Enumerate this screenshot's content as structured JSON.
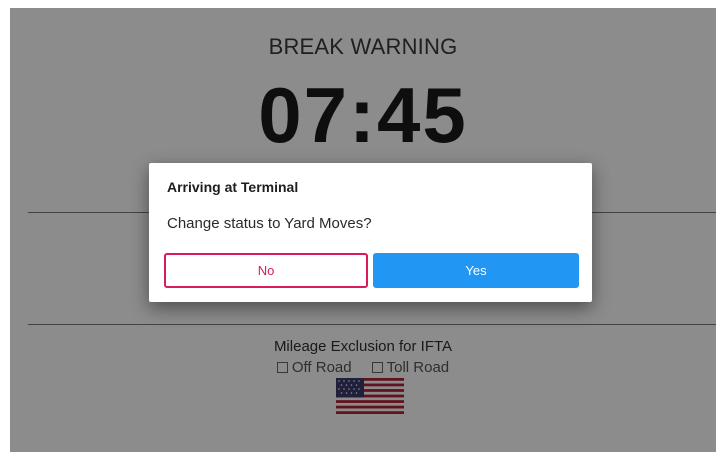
{
  "screen": {
    "title": "BREAK WARNING",
    "timer": "07:45"
  },
  "ifta": {
    "title": "Mileage Exclusion for IFTA",
    "options": [
      {
        "label": "Off Road",
        "checked": false
      },
      {
        "label": "Toll Road",
        "checked": false
      }
    ],
    "flag_icon": "us-flag-icon"
  },
  "dialog": {
    "title": "Arriving at Terminal",
    "message": "Change status to Yard Moves?",
    "no_label": "No",
    "yes_label": "Yes",
    "no_color": "#d81b60",
    "yes_color": "#2196f3"
  }
}
